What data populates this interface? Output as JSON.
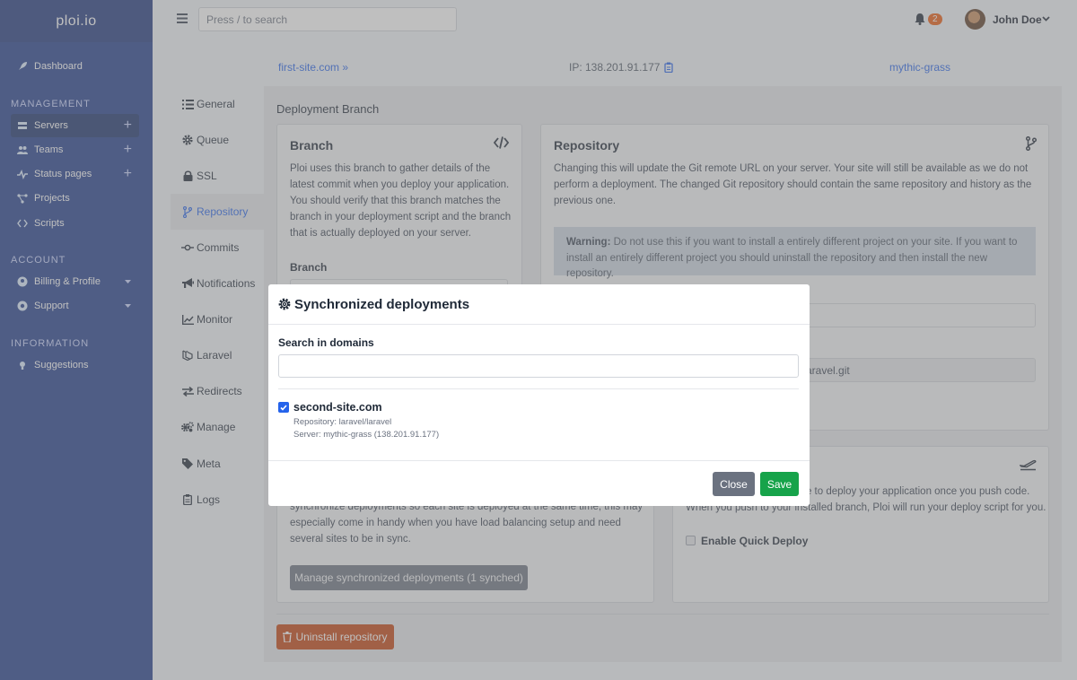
{
  "app": {
    "logo": "ploi.io"
  },
  "sidebar": {
    "items": [
      {
        "label": "Dashboard",
        "icon": "rocket-icon"
      },
      {
        "label": "Servers",
        "icon": "server-icon",
        "action": "+"
      },
      {
        "label": "Teams",
        "icon": "users-icon",
        "action": "+"
      },
      {
        "label": "Status pages",
        "icon": "pulse-icon",
        "action": "+"
      },
      {
        "label": "Projects",
        "icon": "projects-icon"
      },
      {
        "label": "Scripts",
        "icon": "code-icon"
      },
      {
        "label": "Billing & Profile",
        "icon": "user-circle-icon"
      },
      {
        "label": "Support",
        "icon": "support-icon"
      },
      {
        "label": "Suggestions",
        "icon": "lightbulb-icon"
      }
    ],
    "sections": {
      "management": "MANAGEMENT",
      "account": "ACCOUNT",
      "information": "INFORMATION"
    }
  },
  "topbar": {
    "search_placeholder": "Press / to search",
    "notification_count": "2",
    "user_name": "John Doe"
  },
  "info": {
    "site": "first-site.com",
    "ip": "IP: 138.201.91.177",
    "server": "mythic-grass"
  },
  "subnav": [
    {
      "label": "General",
      "icon": "list-icon"
    },
    {
      "label": "Queue",
      "icon": "gear-icon"
    },
    {
      "label": "SSL",
      "icon": "lock-icon"
    },
    {
      "label": "Repository",
      "icon": "git-branch-icon"
    },
    {
      "label": "Commits",
      "icon": "commit-icon"
    },
    {
      "label": "Notifications",
      "icon": "megaphone-icon"
    },
    {
      "label": "Monitor",
      "icon": "chart-line-icon"
    },
    {
      "label": "Laravel",
      "icon": "laravel-icon"
    },
    {
      "label": "Redirects",
      "icon": "arrows-icon"
    },
    {
      "label": "Manage",
      "icon": "cogs-icon"
    },
    {
      "label": "Meta",
      "icon": "tag-icon"
    },
    {
      "label": "Logs",
      "icon": "clipboard-icon"
    }
  ],
  "main": {
    "section_title": "Deployment Branch",
    "branch_card": {
      "title": "Branch",
      "lines": [
        "Ploi uses this branch to gather details of the",
        "latest commit when you deploy your application.",
        "You should verify that this branch matches the",
        "branch in your deployment script and the branch",
        "that is actually deployed on your server."
      ],
      "field_label": "Branch"
    },
    "repository_card": {
      "title": "Repository",
      "lines": [
        "Changing this will update the Git remote URL on your server. Your site will still be available as we do not",
        "perform a deployment. The changed Git repository should contain the same repository and history as the",
        "previous one."
      ],
      "warning_bold": "Warning:",
      "warning_line1": " Do not use this if you want to install a entirely different project on your site. If you want to",
      "warning_line2": "install an entirely different project you should uninstall the repository and then install the new repository.",
      "repo_value_partial": "aravel.git"
    },
    "sync_card": {
      "lines": [
        "synchronize deployments so each site is deployed at the same time, this may",
        "especially come in handy when you have load balancing setup and need",
        "several sites to be in sync."
      ],
      "button": "Manage synchronized deployments (1 synched)"
    },
    "quick_deploy_card": {
      "line1": "ble to deploy your application once you push code.",
      "line2": "When you push to your installed branch, Ploi will run your deploy script for you.",
      "checkbox_label": "Enable Quick Deploy"
    },
    "uninstall_button": "Uninstall repository"
  },
  "modal": {
    "title": "Synchronized deployments",
    "search_label": "Search in domains",
    "search_value": "",
    "items": [
      {
        "domain": "second-site.com",
        "repository": "Repository: laravel/laravel",
        "server": "Server: mythic-grass (138.201.91.177)",
        "checked": true
      }
    ],
    "close": "Close",
    "save": "Save"
  },
  "colors": {
    "sidebar": "#1e3a8a",
    "accent": "#2563eb",
    "save": "#16a34a",
    "danger": "#c2410c"
  }
}
